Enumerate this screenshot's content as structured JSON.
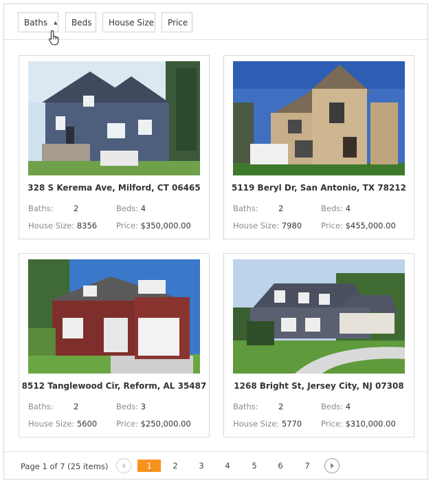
{
  "toolbar": {
    "sort_buttons": [
      {
        "label": "Baths",
        "sorted": "ascending"
      },
      {
        "label": "Beds"
      },
      {
        "label": "House Size"
      },
      {
        "label": "Price"
      }
    ]
  },
  "field_labels": {
    "baths": "Baths:",
    "beds": "Beds:",
    "size": "House Size:",
    "price": "Price:"
  },
  "listings": [
    {
      "address": "328 S Kerema Ave, Milford, CT 06465",
      "baths": "2",
      "beds": "4",
      "size": "8356",
      "price": "$350,000.00"
    },
    {
      "address": "5119 Beryl Dr, San Antonio, TX 78212",
      "baths": "2",
      "beds": "4",
      "size": "7980",
      "price": "$455,000.00"
    },
    {
      "address": "8512 Tanglewood Cir, Reform, AL 35487",
      "baths": "2",
      "beds": "3",
      "size": "5600",
      "price": "$250,000.00"
    },
    {
      "address": "1268 Bright St, Jersey City, NJ 07308",
      "baths": "2",
      "beds": "4",
      "size": "5770",
      "price": "$310,000.00"
    }
  ],
  "pager": {
    "info": "Page 1 of 7 (25 items)",
    "pages": [
      "1",
      "2",
      "3",
      "4",
      "5",
      "6",
      "7"
    ],
    "current": "1"
  },
  "colors": {
    "accent": "#f7921e",
    "border": "#d9d9d9"
  },
  "icons": {
    "prev": "chevron-left-icon",
    "next": "chevron-right-icon",
    "cursor": "hand-pointer-icon"
  }
}
